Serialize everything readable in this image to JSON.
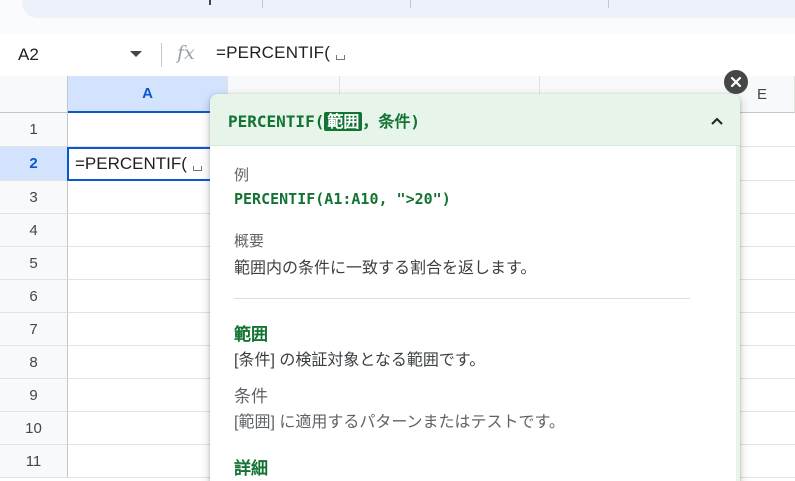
{
  "formula_bar": {
    "cell_reference": "A2",
    "fx_label": "fx",
    "formula": "=PERCENTIF("
  },
  "columns": [
    "A",
    "E"
  ],
  "rows": [
    "1",
    "2",
    "3",
    "4",
    "5",
    "6",
    "7",
    "8",
    "9",
    "10",
    "11"
  ],
  "active_cell": {
    "ref": "A2",
    "content": "=PERCENTIF("
  },
  "help_popup": {
    "title_function": "PERCENTIF(",
    "title_arg_active": "範囲",
    "title_separator": "，",
    "title_arg_rest": "条件",
    "title_close": ")",
    "example_label": "例",
    "example": "PERCENTIF(A1:A10, \">20\")",
    "summary_label": "概要",
    "summary": "範囲内の条件に一致する割合を返します。",
    "args": [
      {
        "name": "範囲",
        "description": "[条件] の検証対象となる範囲です。"
      },
      {
        "name": "条件",
        "description": "[範囲] に適用するパターンまたはテストです。"
      }
    ],
    "details_label": "詳細"
  },
  "colors": {
    "accent_blue": "#0b57d0",
    "help_green": "#137333",
    "help_header_bg": "#e6f4ea",
    "selected_header_bg": "#d3e3fd"
  }
}
